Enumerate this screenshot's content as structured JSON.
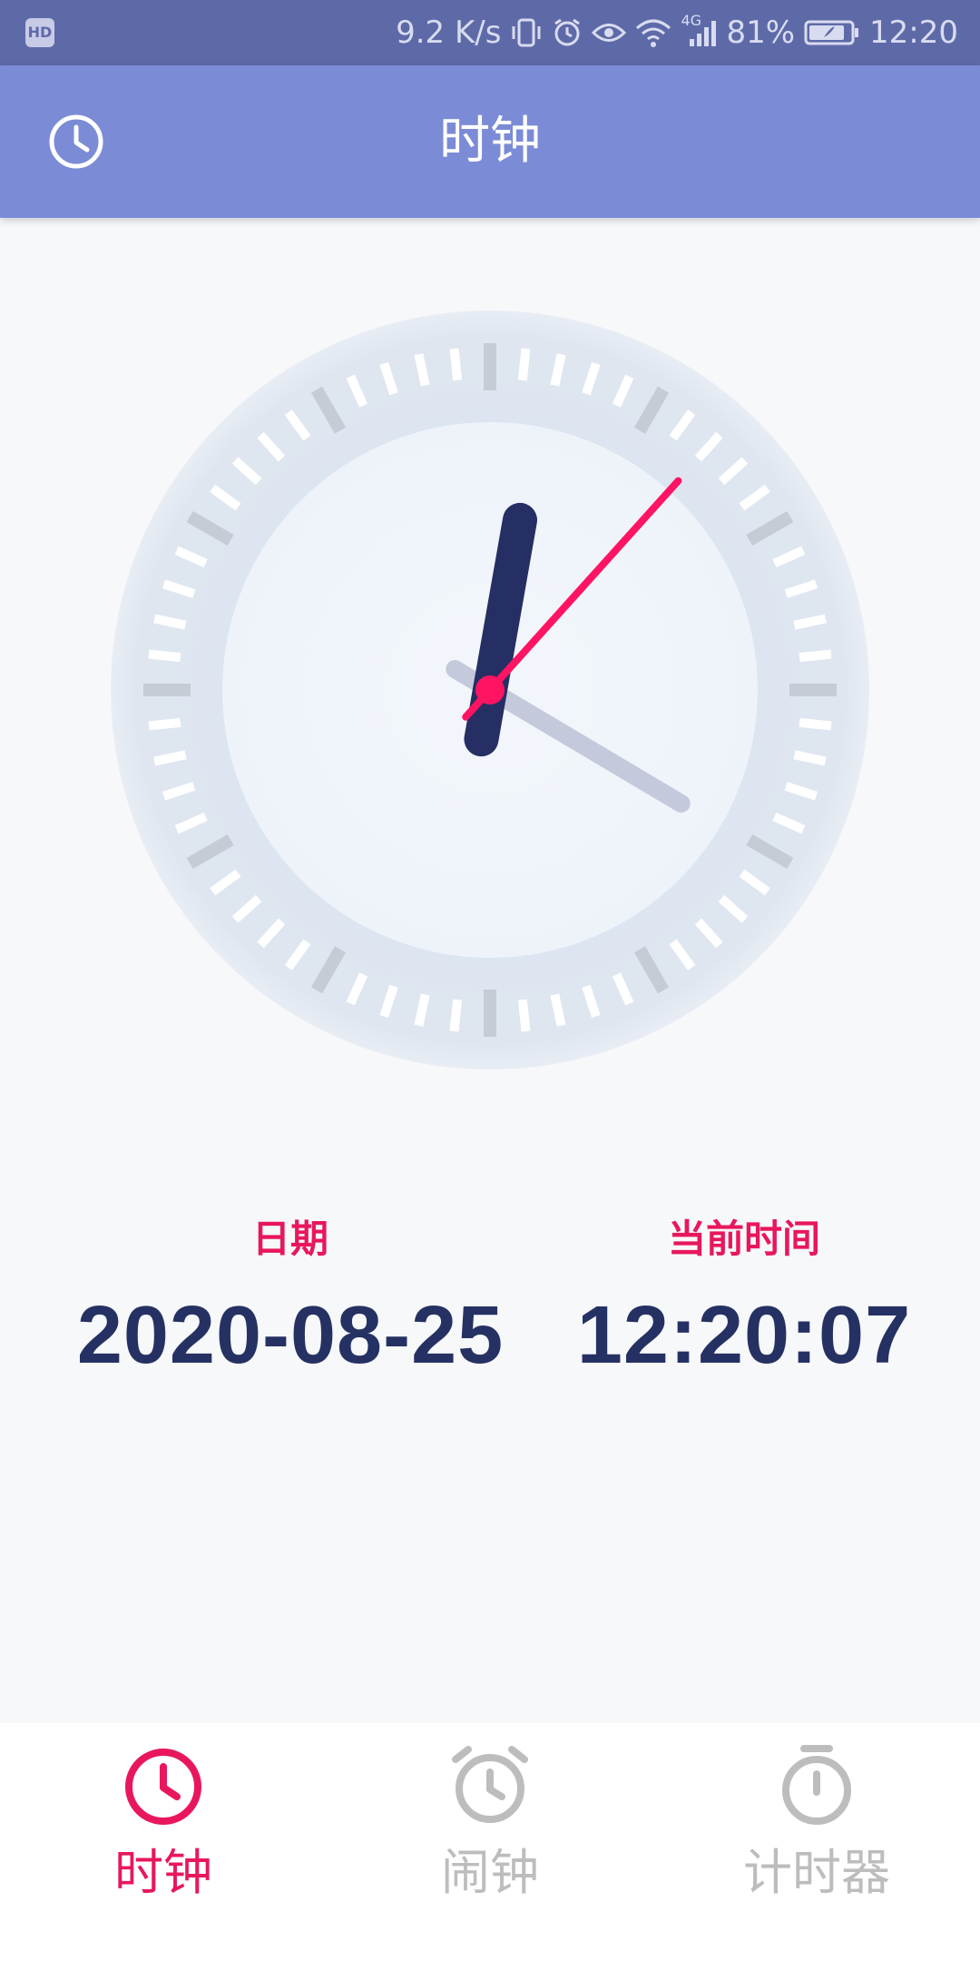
{
  "status_bar": {
    "badge": "HD",
    "network_speed": "9.2 K/s",
    "signal_type": "4G",
    "battery": "81%",
    "time": "12:20"
  },
  "app_bar": {
    "title": "时钟",
    "icon": "clock-icon"
  },
  "clock": {
    "hour": 12,
    "minute": 20,
    "second": 7
  },
  "info": {
    "date_label": "日期",
    "date_value": "2020-08-25",
    "time_label": "当前时间",
    "time_value": "12:20:07"
  },
  "bottom_nav": {
    "items": [
      {
        "label": "时钟",
        "icon": "clock-icon",
        "active": true
      },
      {
        "label": "闹钟",
        "icon": "alarm-clock-icon",
        "active": false
      },
      {
        "label": "计时器",
        "icon": "stopwatch-icon",
        "active": false
      }
    ]
  },
  "colors": {
    "status_bar": "#5e6aa8",
    "app_bar": "#7b8bd6",
    "accent": "#e8175d",
    "hour_hand": "#262f63",
    "minute_hand": "#c5c9dc",
    "second_hand": "#ff1463",
    "inactive": "#bdbdbd"
  }
}
